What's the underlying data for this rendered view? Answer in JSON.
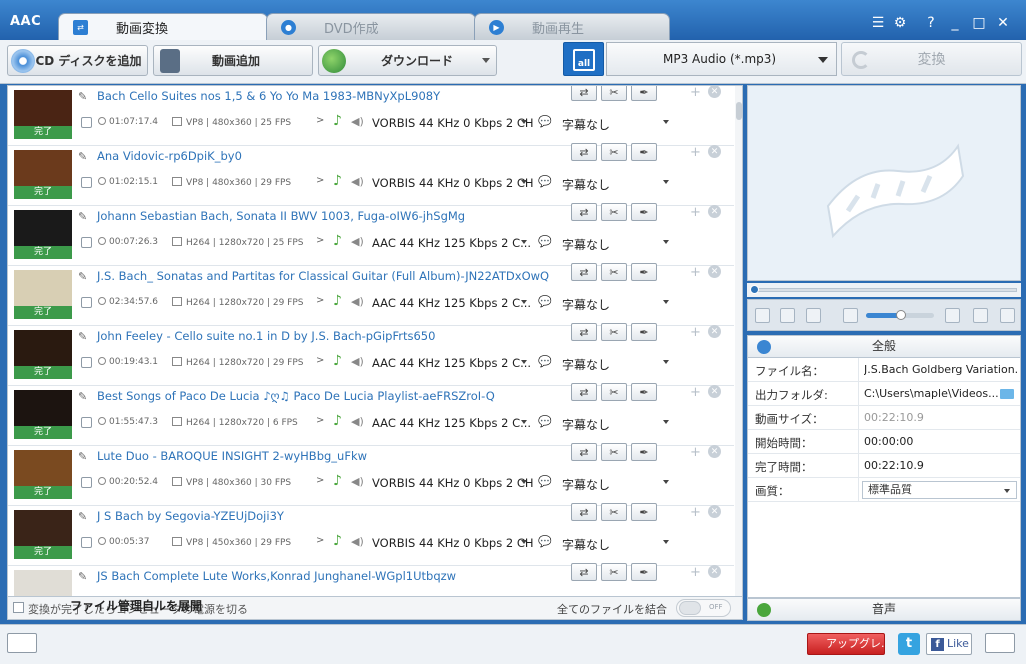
{
  "app": {
    "logo": "AAC"
  },
  "tabs": [
    {
      "label": "動画変換"
    },
    {
      "label": "DVD作成"
    },
    {
      "label": "動画再生"
    }
  ],
  "window_buttons": {
    "help": "?"
  },
  "toolbar": {
    "cd_label": "CD ディスクを追加",
    "add_label": "動画追加",
    "download_label": "ダウンロード",
    "format_label": "MP3 Audio (*.mp3)",
    "convert_label": "変換"
  },
  "status_done": "完了",
  "files": [
    {
      "name": "Bach Cello Suites nos 1,5 & 6 Yo Yo Ma 1983-MBNyXpL908Y",
      "duration": "01:07:17.4",
      "vinfo": "VP8 | 480x360 | 25 FPS",
      "audio": "VORBIS 44 KHz 0 Kbps 2 CH",
      "subtitle": "字幕なし",
      "thumb": "#4a2414"
    },
    {
      "name": "Ana Vidovic-rp6DpiK_by0",
      "duration": "01:02:15.1",
      "vinfo": "VP8 | 480x360 | 29 FPS",
      "audio": "VORBIS 44 KHz 0 Kbps 2 CH",
      "subtitle": "字幕なし",
      "thumb": "#6b3a1c"
    },
    {
      "name": "Johann Sebastian Bach, Sonata II BWV 1003, Fuga-oIW6-jhSgMg",
      "duration": "00:07:26.3",
      "vinfo": "H264 | 1280x720 | 25 FPS",
      "audio": "AAC 44 KHz 125 Kbps 2 C...",
      "subtitle": "字幕なし",
      "thumb": "#1a1a1a"
    },
    {
      "name": "J.S. Bach_ Sonatas and Partitas for Classical Guitar (Full Album)-JN22ATDxOwQ",
      "duration": "02:34:57.6",
      "vinfo": "H264 | 1280x720 | 29 FPS",
      "audio": "AAC 44 KHz 125 Kbps 2 C...",
      "subtitle": "字幕なし",
      "thumb": "#d8cfb4"
    },
    {
      "name": "John Feeley - Cello suite no.1 in D by J.S. Bach-pGipFrts650",
      "duration": "00:19:43.1",
      "vinfo": "H264 | 1280x720 | 29 FPS",
      "audio": "AAC 44 KHz 125 Kbps 2 C...",
      "subtitle": "字幕なし",
      "thumb": "#2a1a10"
    },
    {
      "name": "Best Songs of Paco De Lucia ♪ღ♫ Paco De Lucia Playlist-aeFRSZroI-Q",
      "duration": "01:55:47.3",
      "vinfo": "H264 | 1280x720 | 6 FPS",
      "audio": "AAC 44 KHz 125 Kbps 2 C...",
      "subtitle": "字幕なし",
      "thumb": "#1c1410"
    },
    {
      "name": "Lute Duo - BAROQUE INSIGHT 2-wyHBbg_uFkw",
      "duration": "00:20:52.4",
      "vinfo": "VP8 | 480x360 | 30 FPS",
      "audio": "VORBIS 44 KHz 0 Kbps 2 CH",
      "subtitle": "字幕なし",
      "thumb": "#7a4a20"
    },
    {
      "name": "J S Bach by Segovia-YZEUjDoji3Y",
      "duration": "00:05:37",
      "vinfo": "VP8 | 450x360 | 29 FPS",
      "audio": "VORBIS 44 KHz 0 Kbps 2 CH",
      "subtitle": "字幕なし",
      "thumb": "#3a2418"
    },
    {
      "name": "JS Bach Complete Lute Works,Konrad Junghanel-WGpl1Utbqzw",
      "duration": "",
      "vinfo": "",
      "audio": "",
      "subtitle": "",
      "thumb": "#e0ddd6"
    }
  ],
  "list_footer": {
    "shutdown_label": "変換が完了したらコンピュータの電源を切る",
    "overlay_label": "ファイル管理自ルを展開",
    "join_label": "全てのファイルを結合",
    "toggle_label": "OFF"
  },
  "props_header": "全般",
  "props": [
    {
      "label": "ファイル名：",
      "value": "J.S.Bach Goldberg Variation..."
    },
    {
      "label": "出力フォルダ:",
      "value": "C:\\Users\\maple\\Videos..."
    },
    {
      "label": "動画サイズ：",
      "value": "00:22:10.9",
      "gray": true
    },
    {
      "label": "開始時間：",
      "value": "00:00:00"
    },
    {
      "label": "完了時間：",
      "value": "00:22:10.9"
    },
    {
      "label": "画質：",
      "value": "標準品質"
    }
  ],
  "audio_header": "音声",
  "statusbar": {
    "upgrade_label": "アップグレ...",
    "twitter_label": "t",
    "like_label": "Like"
  },
  "colors": {
    "accent": "#2d7fd3",
    "done": "#3c9a4a",
    "link": "#2e73b8"
  }
}
